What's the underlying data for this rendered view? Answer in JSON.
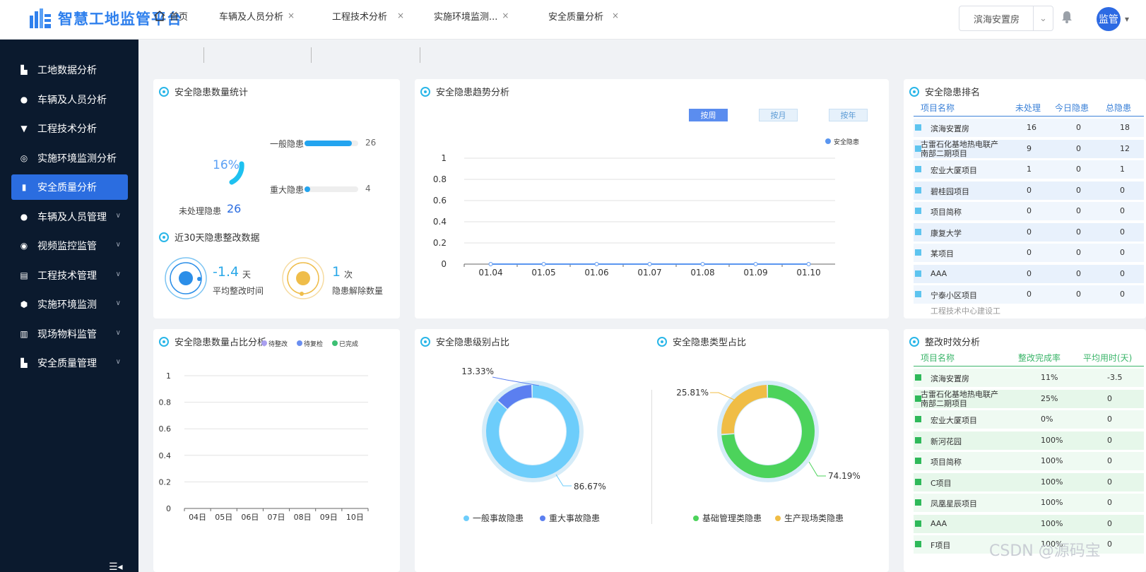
{
  "app": {
    "title": "智慧工地监管平台"
  },
  "header": {
    "project_select": "滨海安置房",
    "user": "监管"
  },
  "sidebar": {
    "items": [
      {
        "label": "工地数据分析",
        "icon": "building-icon",
        "active": false,
        "expandable": false
      },
      {
        "label": "车辆及人员分析",
        "icon": "person-icon",
        "active": false,
        "expandable": false
      },
      {
        "label": "工程技术分析",
        "icon": "funnel-icon",
        "active": false,
        "expandable": false
      },
      {
        "label": "实施环境监测分析",
        "icon": "target-icon",
        "active": false,
        "expandable": false
      },
      {
        "label": "安全质量分析",
        "icon": "bar-chart-icon",
        "active": true,
        "expandable": false
      },
      {
        "label": "车辆及人员管理",
        "icon": "people-icon",
        "active": false,
        "expandable": true
      },
      {
        "label": "视频监控监管",
        "icon": "camera-icon",
        "active": false,
        "expandable": true
      },
      {
        "label": "工程技术管理",
        "icon": "stack-icon",
        "active": false,
        "expandable": true
      },
      {
        "label": "实施环境监测",
        "icon": "shield-icon",
        "active": false,
        "expandable": true
      },
      {
        "label": "现场物料监管",
        "icon": "truck-icon",
        "active": false,
        "expandable": true
      },
      {
        "label": "安全质量管理",
        "icon": "building-icon",
        "active": false,
        "expandable": true
      }
    ]
  },
  "tabs": [
    {
      "label": "首页",
      "closable": false
    },
    {
      "label": "车辆及人员分析",
      "closable": true
    },
    {
      "label": "工程技术分析",
      "closable": true
    },
    {
      "label": "实施环境监测...",
      "closable": true
    },
    {
      "label": "安全质量分析",
      "closable": true,
      "active": true
    }
  ],
  "hazard_stats": {
    "title": "安全隐患数量统计",
    "percent": "16%",
    "general_label": "一般隐患",
    "general_value": 26,
    "major_label": "重大隐患",
    "major_value": 4,
    "unprocessed_label": "未处理隐患",
    "unprocessed_value": "26"
  },
  "rectify30": {
    "title": "近30天隐患整改数据",
    "avg_value": "-1.4",
    "avg_unit": "天",
    "avg_label": "平均整改时间",
    "clear_value": "1",
    "clear_unit": "次",
    "clear_label": "隐患解除数量"
  },
  "trend": {
    "title": "安全隐患趋势分析",
    "buttons": [
      "按周",
      "按月",
      "按年"
    ],
    "legend": "安全隐患"
  },
  "ranking": {
    "title": "安全隐患排名",
    "headers": [
      "项目名称",
      "未处理",
      "今日隐患",
      "总隐患"
    ],
    "rows": [
      [
        "滨海安置房",
        "16",
        "0",
        "18"
      ],
      [
        "古雷石化基地热电联产南部二期项目",
        "9",
        "0",
        "12"
      ],
      [
        "宏业大厦项目",
        "1",
        "0",
        "1"
      ],
      [
        "碧桂园项目",
        "0",
        "0",
        "0"
      ],
      [
        "项目简称",
        "0",
        "0",
        "0"
      ],
      [
        "康复大学",
        "0",
        "0",
        "0"
      ],
      [
        "某项目",
        "0",
        "0",
        "0"
      ],
      [
        "AAA",
        "0",
        "0",
        "0"
      ],
      [
        "宁泰小区项目",
        "0",
        "0",
        "0"
      ]
    ],
    "partial_row": "工程技术中心建设工"
  },
  "ratio": {
    "title": "安全隐患数量占比分析",
    "legend": [
      "待整改",
      "待复检",
      "已完成"
    ]
  },
  "level_share": {
    "title": "安全隐患级别占比",
    "legend": [
      "一般事故隐患",
      "重大事故隐患"
    ],
    "labels": [
      "13.33%",
      "86.67%"
    ]
  },
  "type_share": {
    "title": "安全隐患类型占比",
    "legend": [
      "基础管理类隐患",
      "生产现场类隐患"
    ],
    "labels": [
      "25.81%",
      "74.19%"
    ]
  },
  "efficiency": {
    "title": "整改时效分析",
    "headers": [
      "项目名称",
      "整改完成率",
      "平均用时(天)"
    ],
    "rows": [
      [
        "滨海安置房",
        "11%",
        "-3.5"
      ],
      [
        "古雷石化基地热电联产南部二期项目",
        "25%",
        "0"
      ],
      [
        "宏业大厦项目",
        "0%",
        "0"
      ],
      [
        "新河花园",
        "100%",
        "0"
      ],
      [
        "项目简称",
        "100%",
        "0"
      ],
      [
        "C项目",
        "100%",
        "0"
      ],
      [
        "凤凰星辰项目",
        "100%",
        "0"
      ],
      [
        "AAA",
        "100%",
        "0"
      ],
      [
        "F项目",
        "100%",
        "0"
      ]
    ]
  },
  "watermark": "CSDN @源码宝",
  "colors": {
    "accent": "#2b6de0",
    "sidebar": "#0b1a2e",
    "light_blue": "#6dcdfb",
    "indigo": "#5b7ff0",
    "green": "#4cd35b",
    "yellow": "#f0bd45"
  },
  "chart_data": [
    {
      "type": "line",
      "title": "安全隐患趋势分析",
      "x": [
        "01.04",
        "01.05",
        "01.06",
        "01.07",
        "01.08",
        "01.09",
        "01.10"
      ],
      "series": [
        {
          "name": "安全隐患",
          "values": [
            0,
            0,
            0,
            0,
            0,
            0,
            0
          ]
        }
      ],
      "ylim": [
        0,
        1
      ],
      "yticks": [
        "0",
        "0.2",
        "0.4",
        "0.6",
        "0.8",
        "1"
      ]
    },
    {
      "type": "bar",
      "title": "安全隐患数量占比分析",
      "categories": [
        "04日",
        "05日",
        "06日",
        "07日",
        "08日",
        "09日",
        "10日"
      ],
      "series": [
        {
          "name": "待整改",
          "values": [
            0,
            0,
            0,
            0,
            0,
            0,
            0
          ]
        },
        {
          "name": "待复检",
          "values": [
            0,
            0,
            0,
            0,
            0,
            0,
            0
          ]
        },
        {
          "name": "已完成",
          "values": [
            0,
            0,
            0,
            0,
            0,
            0,
            0
          ]
        }
      ],
      "ylim": [
        0,
        1
      ],
      "yticks": [
        "0",
        "0.2",
        "0.4",
        "0.6",
        "0.8",
        "1"
      ]
    },
    {
      "type": "pie",
      "title": "安全隐患级别占比",
      "categories": [
        "一般事故隐患",
        "重大事故隐患"
      ],
      "values": [
        86.67,
        13.33
      ]
    },
    {
      "type": "pie",
      "title": "安全隐患类型占比",
      "categories": [
        "基础管理类隐患",
        "生产现场类隐患"
      ],
      "values": [
        74.19,
        25.81
      ]
    },
    {
      "type": "bar",
      "title": "安全隐患数量统计",
      "categories": [
        "一般隐患",
        "重大隐患"
      ],
      "values": [
        26,
        4
      ]
    }
  ]
}
